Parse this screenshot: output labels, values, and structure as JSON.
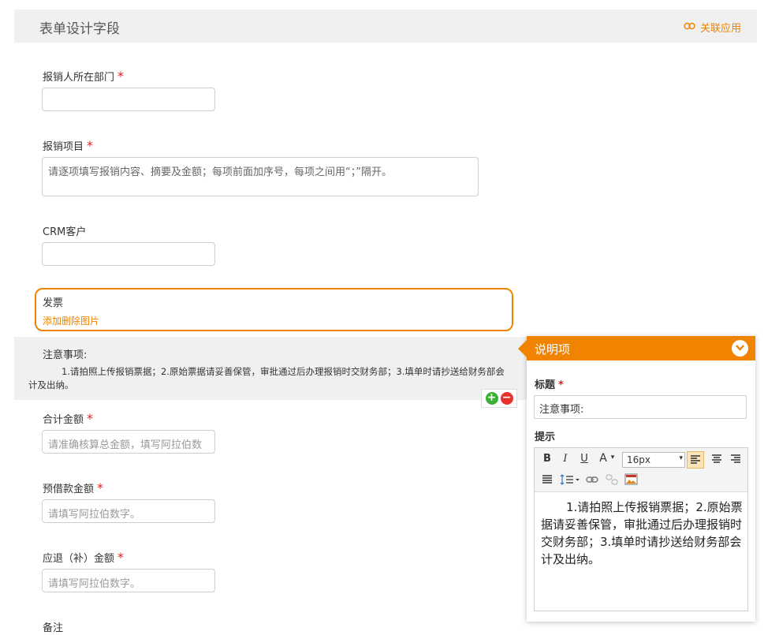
{
  "header": {
    "title": "表单设计字段",
    "link_label": "关联应用"
  },
  "fields": {
    "dept": {
      "label": "报销人所在部门",
      "required": "*"
    },
    "project": {
      "label": "报销项目",
      "required": "*",
      "value": "请逐项填写报销内容、摘要及金额；每项前面加序号，每项之间用“；”隔开。"
    },
    "crm": {
      "label": "CRM客户"
    },
    "invoice": {
      "label": "发票",
      "link": "添加删除图片"
    },
    "total": {
      "label": "合计金额",
      "required": "*",
      "placeholder": "请准确核算总金额，填写阿拉伯数"
    },
    "advance": {
      "label": "预借款金额",
      "required": "*",
      "placeholder": "请填写阿拉伯数字。"
    },
    "refund": {
      "label": "应退（补）金额",
      "required": "*",
      "placeholder": "请填写阿拉伯数字。"
    },
    "remark": {
      "label": "备注"
    }
  },
  "notice": {
    "title": "注意事项:",
    "text": "1.请拍照上传报销票据；2.原始票据请妥善保管，审批通过后办理报销时交财务部；3.填单时请抄送给财务部会计及出纳。"
  },
  "panel": {
    "title": "说明项",
    "title_label": "标题",
    "required": "*",
    "title_value": "注意事项:",
    "hint_label": "提示",
    "toolbar": {
      "bold": "B",
      "italic": "I",
      "underline": "U",
      "font_color": "A",
      "font_size": "16px"
    },
    "content": "1.请拍照上传报销票据；2.原始票据请妥善保管，审批通过后办理报销时交财务部；3.填单时请抄送给财务部会计及出纳。"
  },
  "colors": {
    "accent": "#f08300",
    "required": "#e02020",
    "add": "#3cb034",
    "remove": "#e5322d"
  }
}
